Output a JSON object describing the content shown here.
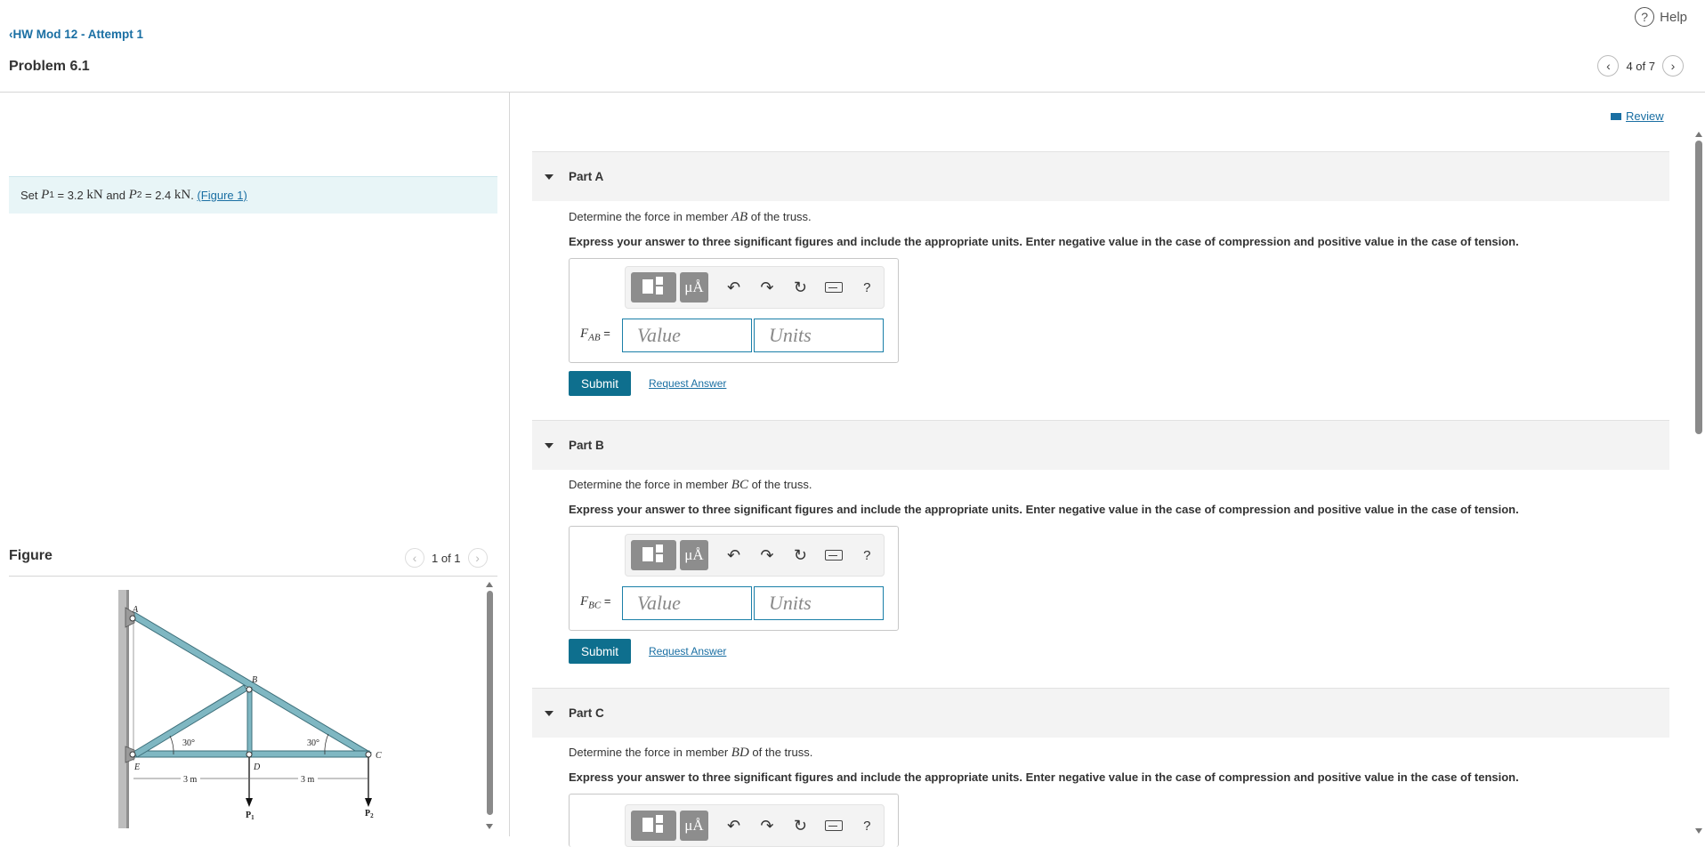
{
  "header": {
    "help_label": "Help",
    "help_icon": "question-circle-icon",
    "back_label": "HW Mod 12 - Attempt 1",
    "problem_title": "Problem 6.1",
    "pager_text": "4 of 7"
  },
  "intro": {
    "prefix": "Set ",
    "p1_var": "P",
    "p1_sub": "1",
    "p1_eq": " = 3.2 ",
    "p1_unit": "kN",
    "and": " and ",
    "p2_var": "P",
    "p2_sub": "2",
    "p2_eq": " = 2.4 ",
    "p2_unit": "kN",
    "period": ". ",
    "figure_link": "(Figure 1)"
  },
  "figure": {
    "label": "Figure",
    "pager_text": "1 of 1",
    "labels": {
      "A": "A",
      "B": "B",
      "C": "C",
      "D": "D",
      "E": "E",
      "angle1": "30°",
      "angle2": "30°",
      "dim1": "3 m",
      "dim2": "3 m",
      "p1": "P",
      "p1_sub": "1",
      "p2": "P",
      "p2_sub": "2"
    },
    "colors": {
      "member": "#7fb7c2",
      "member_edge": "#3d6f7a",
      "wall": "#b9b9b9"
    }
  },
  "review": {
    "label": "Review",
    "icon": "book-icon"
  },
  "parts": [
    {
      "title": "Part A",
      "question_prefix": "Determine the force in member ",
      "member": "AB",
      "question_suffix": " of the truss.",
      "instructions": "Express your answer to three significant figures and include the appropriate units. Enter negative value in the case of compression and positive value in the case of tension.",
      "answer_var": "F",
      "answer_sub": "AB",
      "answer_eq": " =",
      "value_placeholder": "Value",
      "units_placeholder": "Units",
      "submit_label": "Submit",
      "request_label": "Request Answer"
    },
    {
      "title": "Part B",
      "question_prefix": "Determine the force in member ",
      "member": "BC",
      "question_suffix": " of the truss.",
      "instructions": "Express your answer to three significant figures and include the appropriate units. Enter negative value in the case of compression and positive value in the case of tension.",
      "answer_var": "F",
      "answer_sub": "BC",
      "answer_eq": " =",
      "value_placeholder": "Value",
      "units_placeholder": "Units",
      "submit_label": "Submit",
      "request_label": "Request Answer"
    },
    {
      "title": "Part C",
      "question_prefix": "Determine the force in member ",
      "member": "BD",
      "question_suffix": " of the truss.",
      "instructions": "Express your answer to three significant figures and include the appropriate units. Enter negative value in the case of compression and positive value in the case of tension."
    }
  ],
  "toolbar": {
    "template_icon": "templates-icon",
    "units_symbol": "μÅ",
    "undo_glyph": "↶",
    "redo_glyph": "↷",
    "reset_glyph": "↻",
    "keyboard_icon": "keyboard-icon",
    "help_glyph": "?"
  },
  "colors": {
    "accent": "#0e6f8e",
    "link": "#1a6fa3",
    "intro_bg": "#e8f5f7",
    "part_bg": "#f3f3f3"
  }
}
